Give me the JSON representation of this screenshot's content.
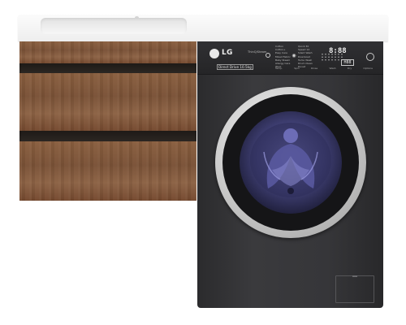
{
  "image": {
    "subject": "bathroom vanity with drawers and built-in washing machine",
    "colors": {
      "countertop": "#f3f3f3",
      "wood": "#7f5639",
      "washer_body": "#333336",
      "door_glass": "#4b4b86",
      "door_ring": "#c6c6c6"
    }
  },
  "washer": {
    "brand": "LG",
    "brand_sub": "ThinQ/Steam",
    "spec_label": "Direct Drive 10.5kg",
    "display_digits": "8:88",
    "display_box": "H88",
    "programs_left": [
      "Cotton",
      "Cotton+",
      "Easy Care",
      "Mixed Fabric",
      "Baby Steam",
      "Allergy Care",
      "Wool"
    ],
    "programs_right": [
      "Quick 30",
      "Speed 14",
      "Silent Wash",
      "Download",
      "Turbo Wash",
      "Drum Clean",
      "Duvet"
    ],
    "panel_labels": [
      "Temp.",
      "Spin",
      "Rinse",
      "Wash",
      "Dry",
      "Options"
    ]
  }
}
